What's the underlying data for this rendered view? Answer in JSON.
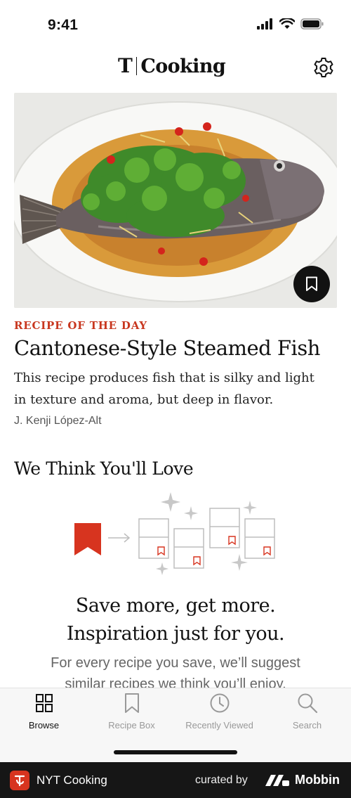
{
  "status": {
    "time": "9:41"
  },
  "header": {
    "brand_mark": "T",
    "brand_name": "Cooking"
  },
  "recipe_of_day": {
    "kicker": "RECIPE OF THE DAY",
    "title": "Cantonese-Style Steamed Fish",
    "description": "This recipe produces fish that is silky and light in texture and aroma, but deep in flavor.",
    "author": "J. Kenji López-Alt"
  },
  "recommend": {
    "title": "We Think You'll Love",
    "promo_line1": "Save more, get more.",
    "promo_line2": "Inspiration just for you.",
    "body_line1": "For every recipe you save, we’ll suggest",
    "body_line2": "similar recipes we think you’ll enjoy."
  },
  "tabs": [
    {
      "label": "Browse",
      "icon": "grid-icon",
      "active": true
    },
    {
      "label": "Recipe Box",
      "icon": "bookmark-icon",
      "active": false
    },
    {
      "label": "Recently Viewed",
      "icon": "clock-icon",
      "active": false
    },
    {
      "label": "Search",
      "icon": "search-icon",
      "active": false
    }
  ],
  "footer": {
    "app_name": "NYT Cooking",
    "curated_by": "curated by",
    "brand": "Mobbin"
  },
  "colors": {
    "accent": "#c8371f",
    "text": "#121212",
    "tab_inactive": "#999999",
    "footer_bg": "#161616"
  }
}
